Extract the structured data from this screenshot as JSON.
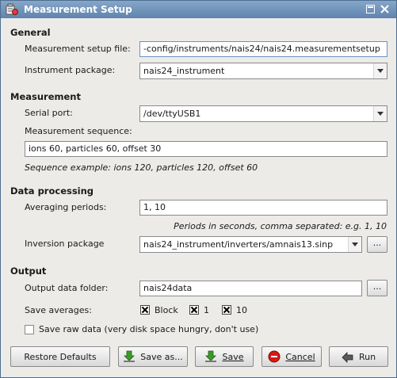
{
  "window": {
    "title": "Measurement Setup"
  },
  "sections": {
    "general": "General",
    "measurement": "Measurement",
    "data_processing": "Data processing",
    "output": "Output"
  },
  "general": {
    "setup_file_label": "Measurement setup file:",
    "setup_file_value": "-config/instruments/nais24/nais24.measurementsetup",
    "instrument_package_label": "Instrument package:",
    "instrument_package_value": "nais24_instrument"
  },
  "measurement": {
    "serial_port_label": "Serial port:",
    "serial_port_value": "/dev/ttyUSB1",
    "sequence_label": "Measurement sequence:",
    "sequence_value": "ions 60, particles 60, offset 30",
    "sequence_example": "Sequence example: ions 120, particles 120, offset 60"
  },
  "data_processing": {
    "averaging_label": "Averaging periods:",
    "averaging_value": "1, 10",
    "averaging_hint": "Periods in seconds, comma separated: e.g. 1, 10",
    "inversion_label": "Inversion package",
    "inversion_value": "nais24_instrument/inverters/amnais13.sinp",
    "browse_label": "..."
  },
  "output": {
    "folder_label": "Output data folder:",
    "folder_value": "nais24data",
    "browse_label": "...",
    "save_averages_label": "Save averages:",
    "averages": [
      {
        "label": "Block",
        "checked": true
      },
      {
        "label": "1",
        "checked": true
      },
      {
        "label": "10",
        "checked": true
      }
    ],
    "save_raw_label": "Save raw data (very disk space hungry, don't use)",
    "save_raw_checked": false
  },
  "buttons": {
    "restore": "Restore Defaults",
    "save_as": "Save as...",
    "save": "Save",
    "cancel": "Cancel",
    "run": "Run"
  },
  "colors": {
    "titlebar": "#6f92ba",
    "window_bg": "#ecebe8",
    "cancel_red": "#d81818",
    "download_green": "#3a9a2a"
  },
  "icons": [
    "app-icon",
    "minimize-icon",
    "close-icon",
    "chevron-down-icon",
    "download-icon",
    "cancel-icon",
    "run-icon"
  ]
}
